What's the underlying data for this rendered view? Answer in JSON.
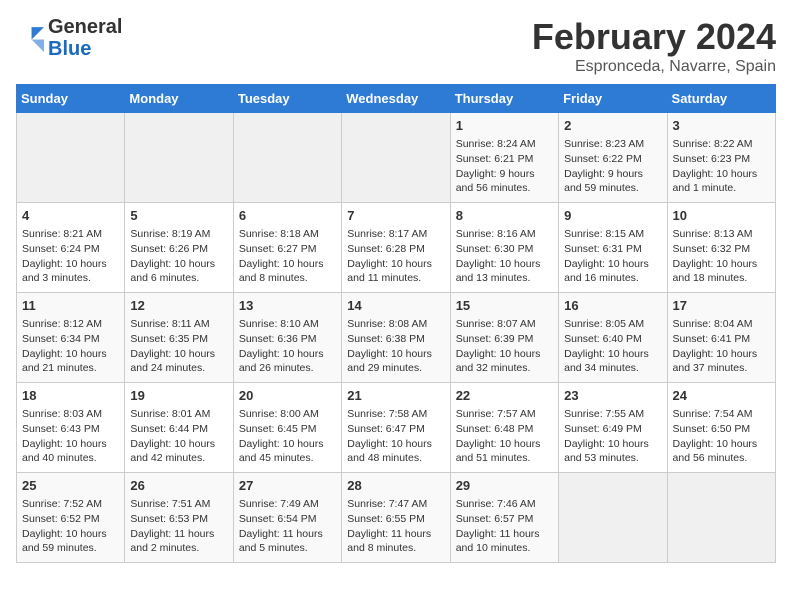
{
  "header": {
    "logo_general": "General",
    "logo_blue": "Blue",
    "month_title": "February 2024",
    "location": "Espronceda, Navarre, Spain"
  },
  "weekdays": [
    "Sunday",
    "Monday",
    "Tuesday",
    "Wednesday",
    "Thursday",
    "Friday",
    "Saturday"
  ],
  "weeks": [
    [
      {
        "day": "",
        "empty": true
      },
      {
        "day": "",
        "empty": true
      },
      {
        "day": "",
        "empty": true
      },
      {
        "day": "",
        "empty": true
      },
      {
        "day": "1",
        "sunrise": "8:24 AM",
        "sunset": "6:21 PM",
        "daylight": "9 hours and 56 minutes."
      },
      {
        "day": "2",
        "sunrise": "8:23 AM",
        "sunset": "6:22 PM",
        "daylight": "9 hours and 59 minutes."
      },
      {
        "day": "3",
        "sunrise": "8:22 AM",
        "sunset": "6:23 PM",
        "daylight": "10 hours and 1 minute."
      }
    ],
    [
      {
        "day": "4",
        "sunrise": "8:21 AM",
        "sunset": "6:24 PM",
        "daylight": "10 hours and 3 minutes."
      },
      {
        "day": "5",
        "sunrise": "8:19 AM",
        "sunset": "6:26 PM",
        "daylight": "10 hours and 6 minutes."
      },
      {
        "day": "6",
        "sunrise": "8:18 AM",
        "sunset": "6:27 PM",
        "daylight": "10 hours and 8 minutes."
      },
      {
        "day": "7",
        "sunrise": "8:17 AM",
        "sunset": "6:28 PM",
        "daylight": "10 hours and 11 minutes."
      },
      {
        "day": "8",
        "sunrise": "8:16 AM",
        "sunset": "6:30 PM",
        "daylight": "10 hours and 13 minutes."
      },
      {
        "day": "9",
        "sunrise": "8:15 AM",
        "sunset": "6:31 PM",
        "daylight": "10 hours and 16 minutes."
      },
      {
        "day": "10",
        "sunrise": "8:13 AM",
        "sunset": "6:32 PM",
        "daylight": "10 hours and 18 minutes."
      }
    ],
    [
      {
        "day": "11",
        "sunrise": "8:12 AM",
        "sunset": "6:34 PM",
        "daylight": "10 hours and 21 minutes."
      },
      {
        "day": "12",
        "sunrise": "8:11 AM",
        "sunset": "6:35 PM",
        "daylight": "10 hours and 24 minutes."
      },
      {
        "day": "13",
        "sunrise": "8:10 AM",
        "sunset": "6:36 PM",
        "daylight": "10 hours and 26 minutes."
      },
      {
        "day": "14",
        "sunrise": "8:08 AM",
        "sunset": "6:38 PM",
        "daylight": "10 hours and 29 minutes."
      },
      {
        "day": "15",
        "sunrise": "8:07 AM",
        "sunset": "6:39 PM",
        "daylight": "10 hours and 32 minutes."
      },
      {
        "day": "16",
        "sunrise": "8:05 AM",
        "sunset": "6:40 PM",
        "daylight": "10 hours and 34 minutes."
      },
      {
        "day": "17",
        "sunrise": "8:04 AM",
        "sunset": "6:41 PM",
        "daylight": "10 hours and 37 minutes."
      }
    ],
    [
      {
        "day": "18",
        "sunrise": "8:03 AM",
        "sunset": "6:43 PM",
        "daylight": "10 hours and 40 minutes."
      },
      {
        "day": "19",
        "sunrise": "8:01 AM",
        "sunset": "6:44 PM",
        "daylight": "10 hours and 42 minutes."
      },
      {
        "day": "20",
        "sunrise": "8:00 AM",
        "sunset": "6:45 PM",
        "daylight": "10 hours and 45 minutes."
      },
      {
        "day": "21",
        "sunrise": "7:58 AM",
        "sunset": "6:47 PM",
        "daylight": "10 hours and 48 minutes."
      },
      {
        "day": "22",
        "sunrise": "7:57 AM",
        "sunset": "6:48 PM",
        "daylight": "10 hours and 51 minutes."
      },
      {
        "day": "23",
        "sunrise": "7:55 AM",
        "sunset": "6:49 PM",
        "daylight": "10 hours and 53 minutes."
      },
      {
        "day": "24",
        "sunrise": "7:54 AM",
        "sunset": "6:50 PM",
        "daylight": "10 hours and 56 minutes."
      }
    ],
    [
      {
        "day": "25",
        "sunrise": "7:52 AM",
        "sunset": "6:52 PM",
        "daylight": "10 hours and 59 minutes."
      },
      {
        "day": "26",
        "sunrise": "7:51 AM",
        "sunset": "6:53 PM",
        "daylight": "11 hours and 2 minutes."
      },
      {
        "day": "27",
        "sunrise": "7:49 AM",
        "sunset": "6:54 PM",
        "daylight": "11 hours and 5 minutes."
      },
      {
        "day": "28",
        "sunrise": "7:47 AM",
        "sunset": "6:55 PM",
        "daylight": "11 hours and 8 minutes."
      },
      {
        "day": "29",
        "sunrise": "7:46 AM",
        "sunset": "6:57 PM",
        "daylight": "11 hours and 10 minutes."
      },
      {
        "day": "",
        "empty": true
      },
      {
        "day": "",
        "empty": true
      }
    ]
  ]
}
